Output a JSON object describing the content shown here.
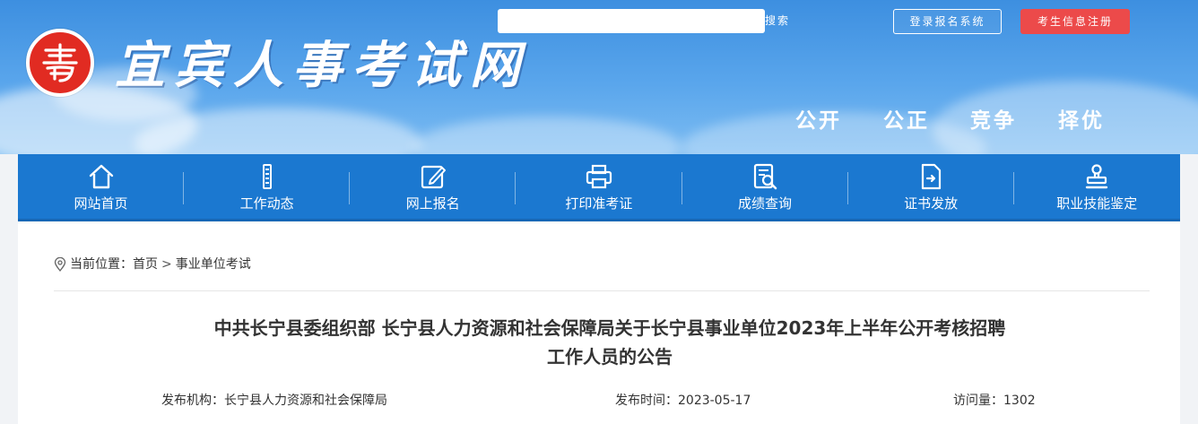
{
  "header": {
    "site_title": "宜宾人事考试网",
    "logo_name": "yibin-seal-logo",
    "search": {
      "placeholder": "",
      "button": "搜索"
    },
    "login_button": "登录报名系统",
    "register_button": "考生信息注册",
    "slogans": [
      "公开",
      "公正",
      "竞争",
      "择优"
    ],
    "colors": {
      "sky": "#4a9be6",
      "register": "#ec4a4a",
      "logo": "#e12b22"
    }
  },
  "nav": {
    "items": [
      {
        "label": "网站首页",
        "icon": "home-icon"
      },
      {
        "label": "工作动态",
        "icon": "news-icon"
      },
      {
        "label": "网上报名",
        "icon": "edit-icon"
      },
      {
        "label": "打印准考证",
        "icon": "printer-icon"
      },
      {
        "label": "成绩查询",
        "icon": "search-doc-icon"
      },
      {
        "label": "证书发放",
        "icon": "certificate-icon"
      },
      {
        "label": "职业技能鉴定",
        "icon": "stamp-icon"
      }
    ],
    "color": "#1b78d0"
  },
  "breadcrumb": {
    "prefix": "当前位置：",
    "items": [
      "首页",
      "事业单位考试"
    ],
    "separator": ">"
  },
  "article": {
    "title_line1": "中共长宁县委组织部 长宁县人力资源和社会保障局关于长宁县事业单位2023年上半年公开考核招聘",
    "title_line2": "工作人员的公告",
    "publisher_label": "发布机构：",
    "publisher": "长宁县人力资源和社会保障局",
    "date_label": "发布时间：",
    "date": "2023-05-17",
    "views_label": "访问量：",
    "views": "1302"
  }
}
